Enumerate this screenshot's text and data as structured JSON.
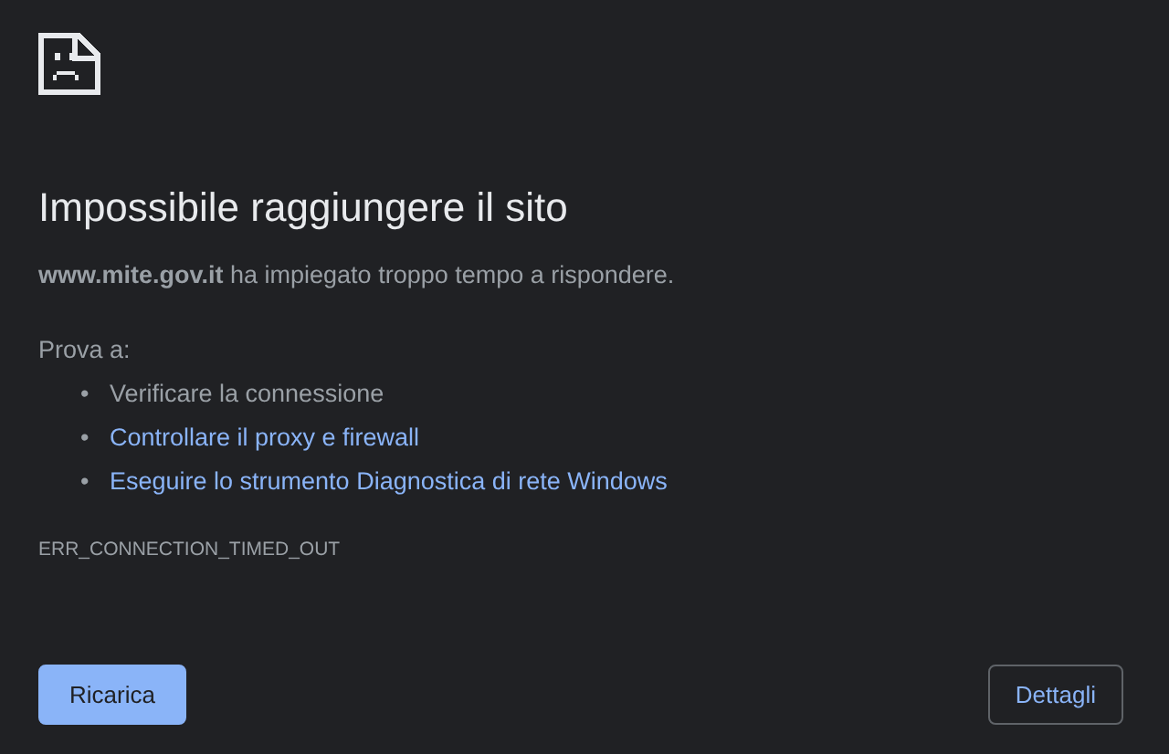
{
  "heading": "Impossibile raggiungere il sito",
  "message": "**www.mite.gov.it** ha impiegato troppo tempo a rispondere.",
  "suggestions_intro": "Prova a:",
  "suggestions": [
    {
      "kind": "text",
      "bullet": "•",
      "label": "Verificare la connessione"
    },
    {
      "kind": "link",
      "bullet": "•",
      "label": "Controllare il proxy e firewall"
    },
    {
      "kind": "link",
      "bullet": "•",
      "label": "Eseguire lo strumento Diagnostica di rete Windows"
    }
  ],
  "error_code": "ERR_CONNECTION_TIMED_OUT",
  "buttons": [
    {
      "kind": "primary",
      "label": "Ricarica"
    },
    {
      "kind": "secondary",
      "label": "Dettagli"
    }
  ]
}
